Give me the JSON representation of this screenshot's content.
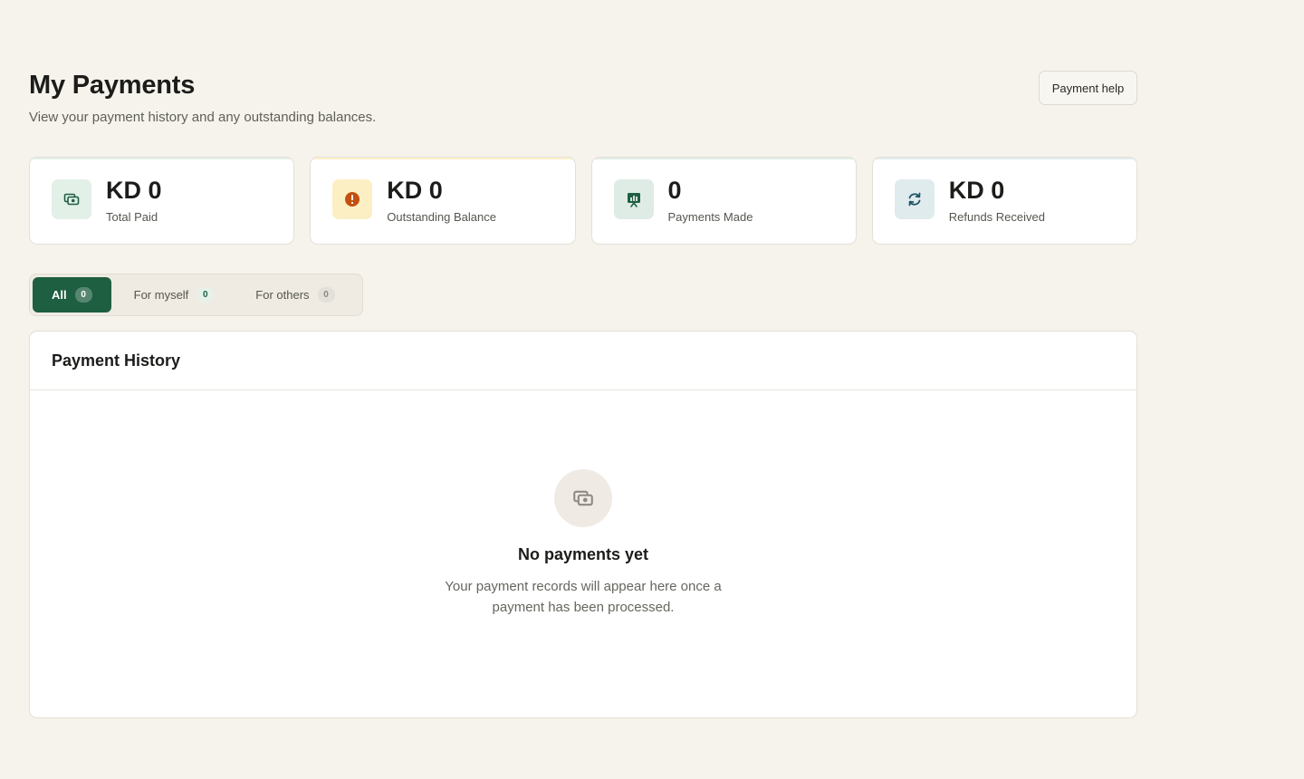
{
  "header": {
    "title": "My Payments",
    "subtitle": "View your payment history and any outstanding balances.",
    "help_label": "Payment help"
  },
  "stats": [
    {
      "value": "KD 0",
      "label": "Total Paid",
      "icon": "money-icon",
      "accent": "#1e5e41"
    },
    {
      "value": "KD 0",
      "label": "Outstanding Balance",
      "icon": "alert-icon",
      "accent": "#c2500f"
    },
    {
      "value": "0",
      "label": "Payments Made",
      "icon": "receipt-chart-icon",
      "accent": "#1e5e41"
    },
    {
      "value": "KD 0",
      "label": "Refunds Received",
      "icon": "refresh-icon",
      "accent": "#1f5566"
    }
  ],
  "tabs": [
    {
      "label": "All",
      "count": "0",
      "active": true
    },
    {
      "label": "For myself",
      "count": "0"
    },
    {
      "label": "For others",
      "count": "0"
    }
  ],
  "history": {
    "title": "Payment History",
    "empty_title": "No payments yet",
    "empty_text": "Your payment records will appear here once a payment has been processed."
  },
  "colors": {
    "primary": "#1e5e41",
    "background": "#f6f3ec",
    "warning": "#c2500f"
  }
}
